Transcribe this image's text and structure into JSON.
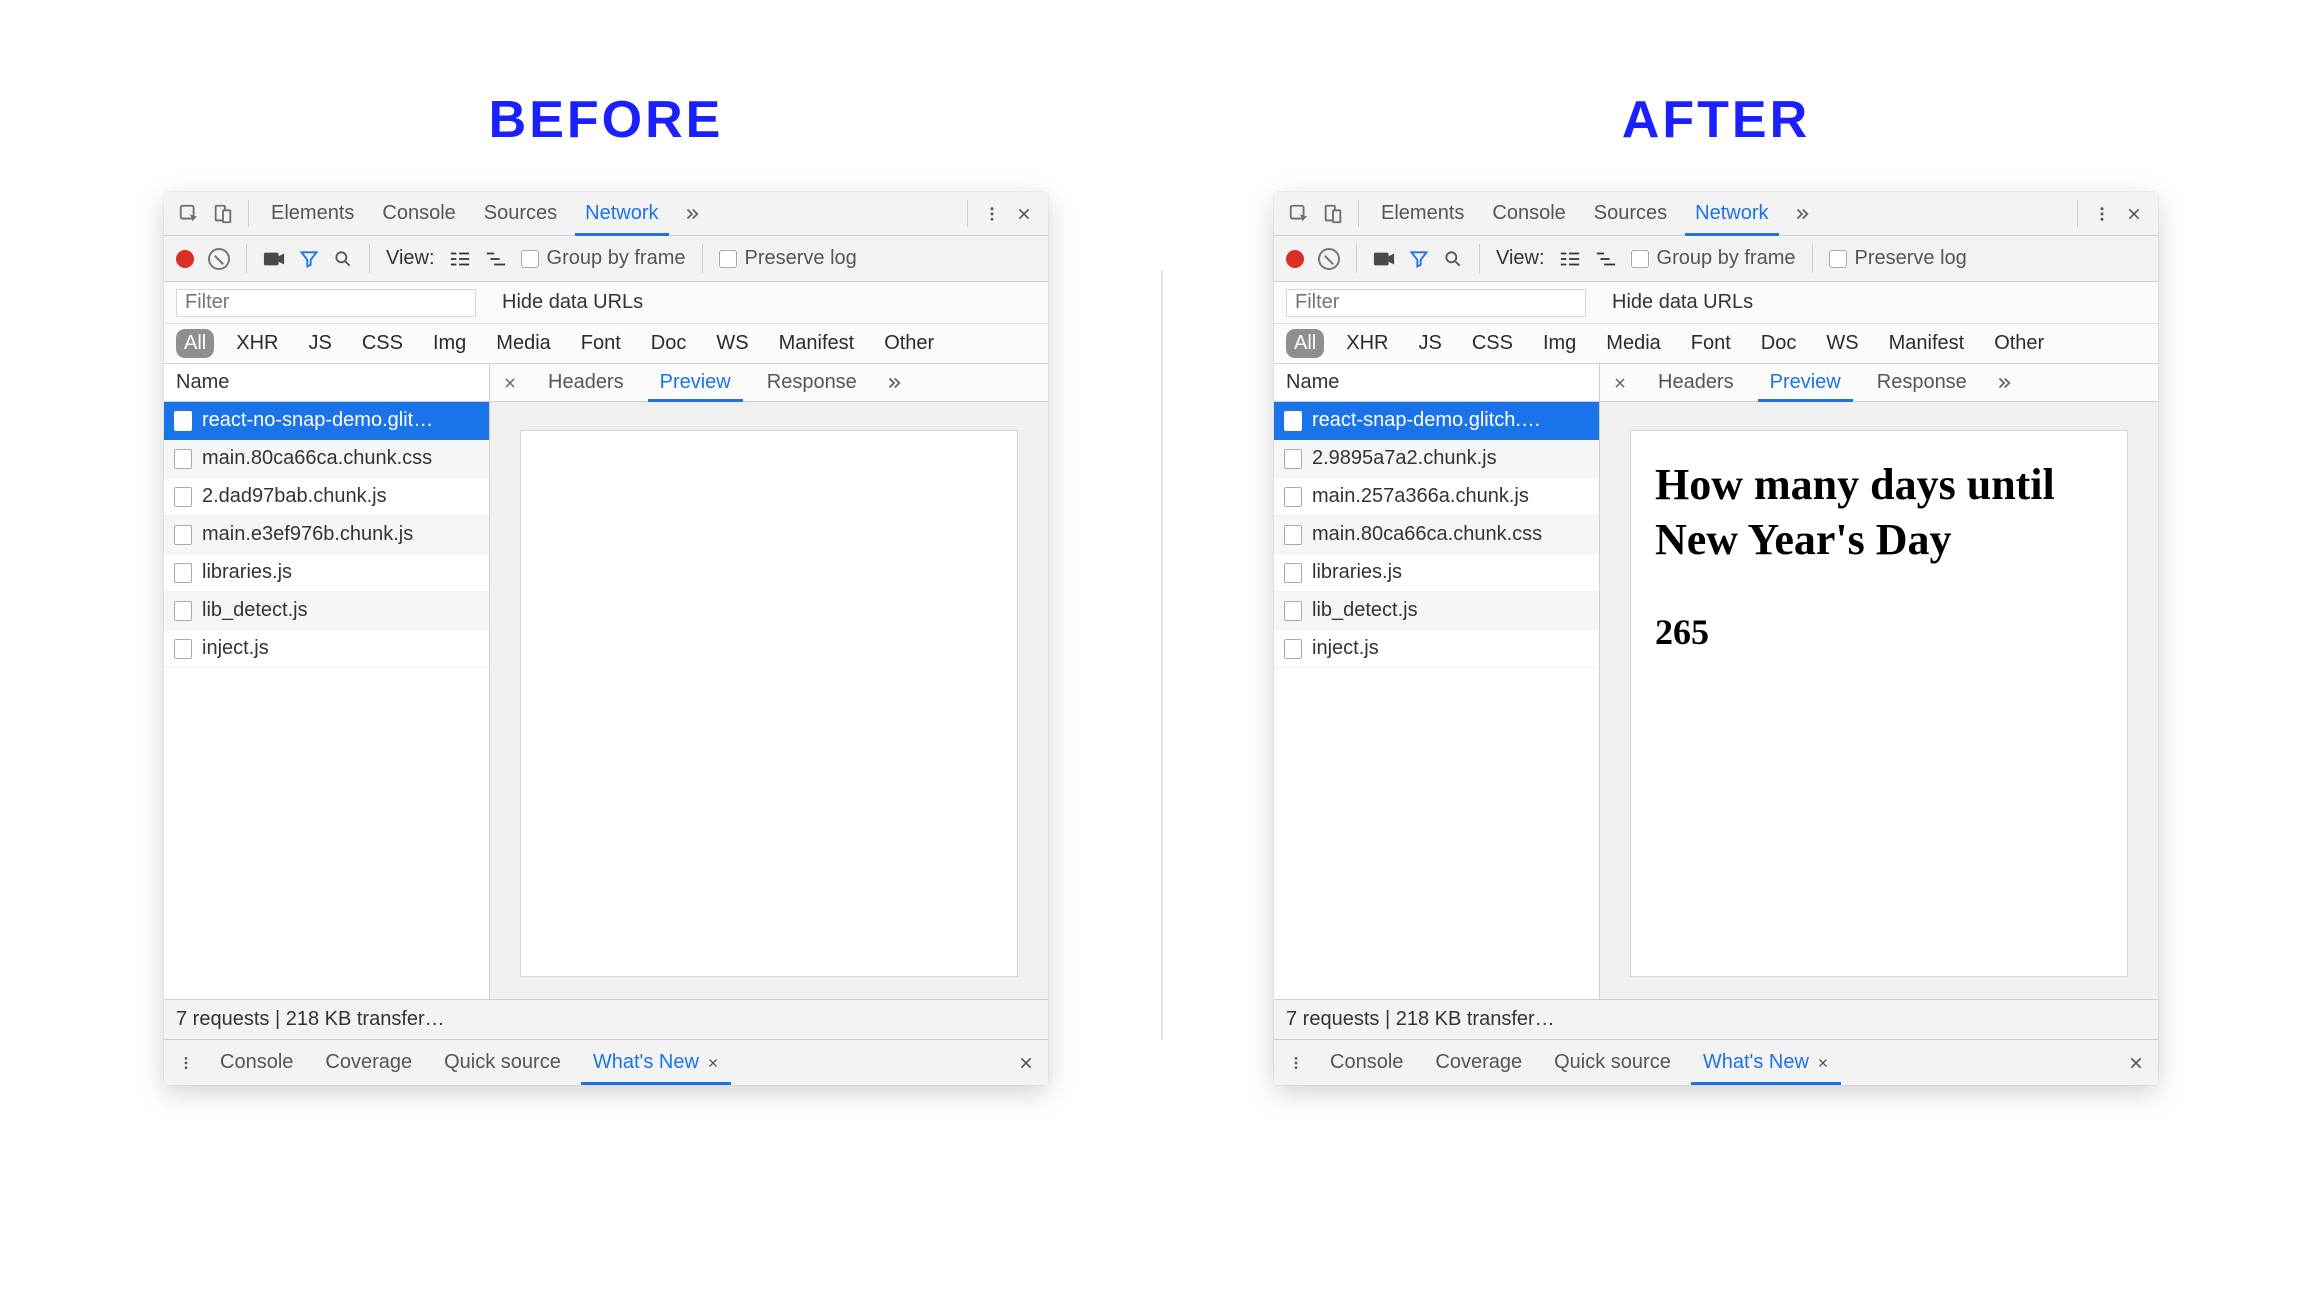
{
  "labels": {
    "before": "BEFORE",
    "after": "AFTER"
  },
  "mainTabs": {
    "elements": "Elements",
    "console": "Console",
    "sources": "Sources",
    "network": "Network"
  },
  "toolbar": {
    "viewLabel": "View:",
    "groupByFrame": "Group by frame",
    "preserveLog": "Preserve log"
  },
  "filterRow": {
    "placeholder": "Filter",
    "hideDataUrls": "Hide data URLs"
  },
  "typeFilters": [
    "All",
    "XHR",
    "JS",
    "CSS",
    "Img",
    "Media",
    "Font",
    "Doc",
    "WS",
    "Manifest",
    "Other"
  ],
  "requestList": {
    "header": "Name",
    "before": [
      {
        "name": "react-no-snap-demo.glit…",
        "selected": true
      },
      {
        "name": "main.80ca66ca.chunk.css"
      },
      {
        "name": "2.dad97bab.chunk.js"
      },
      {
        "name": "main.e3ef976b.chunk.js"
      },
      {
        "name": "libraries.js"
      },
      {
        "name": "lib_detect.js"
      },
      {
        "name": "inject.js"
      }
    ],
    "after": [
      {
        "name": "react-snap-demo.glitch.…",
        "selected": true
      },
      {
        "name": "2.9895a7a2.chunk.js"
      },
      {
        "name": "main.257a366a.chunk.js"
      },
      {
        "name": "main.80ca66ca.chunk.css"
      },
      {
        "name": "libraries.js"
      },
      {
        "name": "lib_detect.js"
      },
      {
        "name": "inject.js"
      }
    ]
  },
  "detailTabs": {
    "headers": "Headers",
    "preview": "Preview",
    "response": "Response"
  },
  "preview": {
    "after": {
      "title": "How many days until New Year's Day",
      "count": "265"
    }
  },
  "status": {
    "before": "7 requests | 218 KB transfer…",
    "after": "7 requests | 218 KB transfer…"
  },
  "drawerTabs": {
    "console": "Console",
    "coverage": "Coverage",
    "quickSource": "Quick source",
    "whatsNew": "What's New"
  }
}
